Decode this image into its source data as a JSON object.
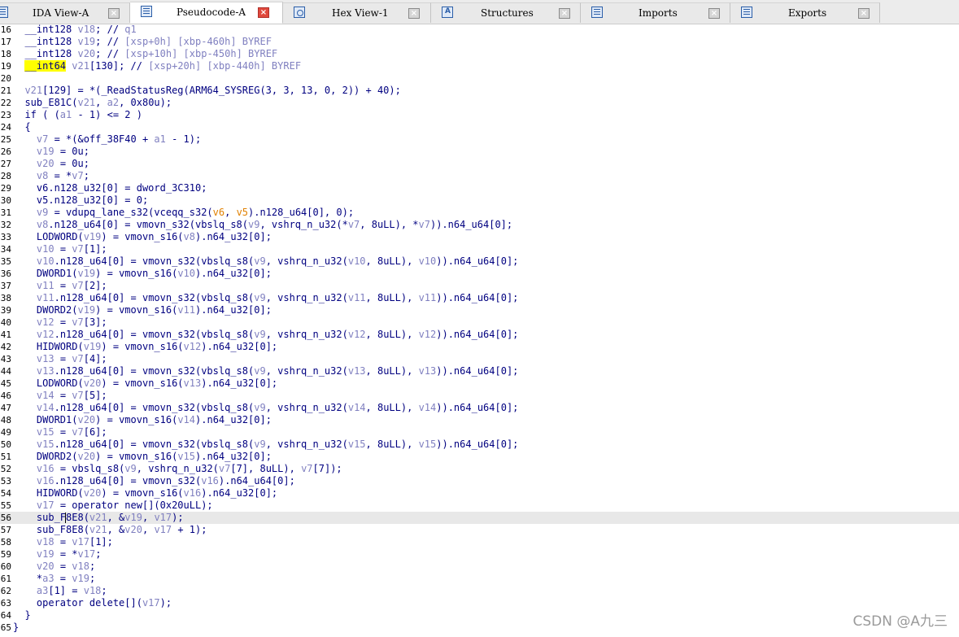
{
  "tabs": [
    {
      "label": "IDA View-A",
      "icon": "ida-view-icon",
      "active": false
    },
    {
      "label": "Pseudocode-A",
      "icon": "pseudocode-icon",
      "active": true
    },
    {
      "label": "Hex View-1",
      "icon": "hex-view-icon",
      "active": false
    },
    {
      "label": "Structures",
      "icon": "structures-icon",
      "active": false
    },
    {
      "label": "Imports",
      "icon": "imports-icon",
      "active": false
    },
    {
      "label": "Exports",
      "icon": "exports-icon",
      "active": false
    }
  ],
  "close_glyph": "×",
  "code_lines": [
    {
      "n": "16",
      "text": "  __int128 v18; // q1"
    },
    {
      "n": "17",
      "text": "  __int128 v19; // [xsp+0h] [xbp-460h] BYREF"
    },
    {
      "n": "18",
      "text": "  __int128 v20; // [xsp+10h] [xbp-450h] BYREF"
    },
    {
      "n": "19",
      "text": "  __int64 v21[130]; // [xsp+20h] [xbp-440h] BYREF"
    },
    {
      "n": "20",
      "text": ""
    },
    {
      "n": "21",
      "text": "  v21[129] = *(_ReadStatusReg(ARM64_SYSREG(3, 3, 13, 0, 2)) + 40);"
    },
    {
      "n": "22",
      "text": "  sub_E81C(v21, a2, 0x80u);"
    },
    {
      "n": "23",
      "text": "  if ( (a1 - 1) <= 2 )"
    },
    {
      "n": "24",
      "text": "  {"
    },
    {
      "n": "25",
      "text": "    v7 = *(&off_38F40 + a1 - 1);"
    },
    {
      "n": "26",
      "text": "    v19 = 0u;"
    },
    {
      "n": "27",
      "text": "    v20 = 0u;"
    },
    {
      "n": "28",
      "text": "    v8 = *v7;"
    },
    {
      "n": "29",
      "text": "    v6.n128_u32[0] = dword_3C310;"
    },
    {
      "n": "30",
      "text": "    v5.n128_u32[0] = 0;"
    },
    {
      "n": "31",
      "text": "    v9 = vdupq_lane_s32(vceqq_s32(v6, v5).n128_u64[0], 0);"
    },
    {
      "n": "32",
      "text": "    v8.n128_u64[0] = vmovn_s32(vbslq_s8(v9, vshrq_n_u32(*v7, 8uLL), *v7)).n64_u64[0];"
    },
    {
      "n": "33",
      "text": "    LODWORD(v19) = vmovn_s16(v8).n64_u32[0];"
    },
    {
      "n": "34",
      "text": "    v10 = v7[1];"
    },
    {
      "n": "35",
      "text": "    v10.n128_u64[0] = vmovn_s32(vbslq_s8(v9, vshrq_n_u32(v10, 8uLL), v10)).n64_u64[0];"
    },
    {
      "n": "36",
      "text": "    DWORD1(v19) = vmovn_s16(v10).n64_u32[0];"
    },
    {
      "n": "37",
      "text": "    v11 = v7[2];"
    },
    {
      "n": "38",
      "text": "    v11.n128_u64[0] = vmovn_s32(vbslq_s8(v9, vshrq_n_u32(v11, 8uLL), v11)).n64_u64[0];"
    },
    {
      "n": "39",
      "text": "    DWORD2(v19) = vmovn_s16(v11).n64_u32[0];"
    },
    {
      "n": "40",
      "text": "    v12 = v7[3];"
    },
    {
      "n": "41",
      "text": "    v12.n128_u64[0] = vmovn_s32(vbslq_s8(v9, vshrq_n_u32(v12, 8uLL), v12)).n64_u64[0];"
    },
    {
      "n": "42",
      "text": "    HIDWORD(v19) = vmovn_s16(v12).n64_u32[0];"
    },
    {
      "n": "43",
      "text": "    v13 = v7[4];"
    },
    {
      "n": "44",
      "text": "    v13.n128_u64[0] = vmovn_s32(vbslq_s8(v9, vshrq_n_u32(v13, 8uLL), v13)).n64_u64[0];"
    },
    {
      "n": "45",
      "text": "    LODWORD(v20) = vmovn_s16(v13).n64_u32[0];"
    },
    {
      "n": "46",
      "text": "    v14 = v7[5];"
    },
    {
      "n": "47",
      "text": "    v14.n128_u64[0] = vmovn_s32(vbslq_s8(v9, vshrq_n_u32(v14, 8uLL), v14)).n64_u64[0];"
    },
    {
      "n": "48",
      "text": "    DWORD1(v20) = vmovn_s16(v14).n64_u32[0];"
    },
    {
      "n": "49",
      "text": "    v15 = v7[6];"
    },
    {
      "n": "50",
      "text": "    v15.n128_u64[0] = vmovn_s32(vbslq_s8(v9, vshrq_n_u32(v15, 8uLL), v15)).n64_u64[0];"
    },
    {
      "n": "51",
      "text": "    DWORD2(v20) = vmovn_s16(v15).n64_u32[0];"
    },
    {
      "n": "52",
      "text": "    v16 = vbslq_s8(v9, vshrq_n_u32(v7[7], 8uLL), v7[7]);"
    },
    {
      "n": "53",
      "text": "    v16.n128_u64[0] = vmovn_s32(v16).n64_u64[0];"
    },
    {
      "n": "54",
      "text": "    HIDWORD(v20) = vmovn_s16(v16).n64_u32[0];"
    },
    {
      "n": "55",
      "text": "    v17 = operator new[](0x20uLL);"
    },
    {
      "n": "56",
      "text": "    sub_F8E8(v21, &v19, v17);"
    },
    {
      "n": "57",
      "text": "    sub_F8E8(v21, &v20, v17 + 1);"
    },
    {
      "n": "58",
      "text": "    v18 = v17[1];"
    },
    {
      "n": "59",
      "text": "    v19 = *v17;"
    },
    {
      "n": "60",
      "text": "    v20 = v18;"
    },
    {
      "n": "61",
      "text": "    *a3 = v19;"
    },
    {
      "n": "62",
      "text": "    a3[1] = v18;"
    },
    {
      "n": "63",
      "text": "    operator delete[](v17);"
    },
    {
      "n": "64",
      "text": "  }"
    },
    {
      "n": "65",
      "text": "}"
    }
  ],
  "current_line": "56",
  "watermark": "CSDN @A九三",
  "colors": {
    "keyword": "#000080",
    "variable": "#8080c0",
    "highlight": "#ffff00",
    "current_line_bg": "#e8e8e8",
    "close_active": "#e0493d"
  }
}
